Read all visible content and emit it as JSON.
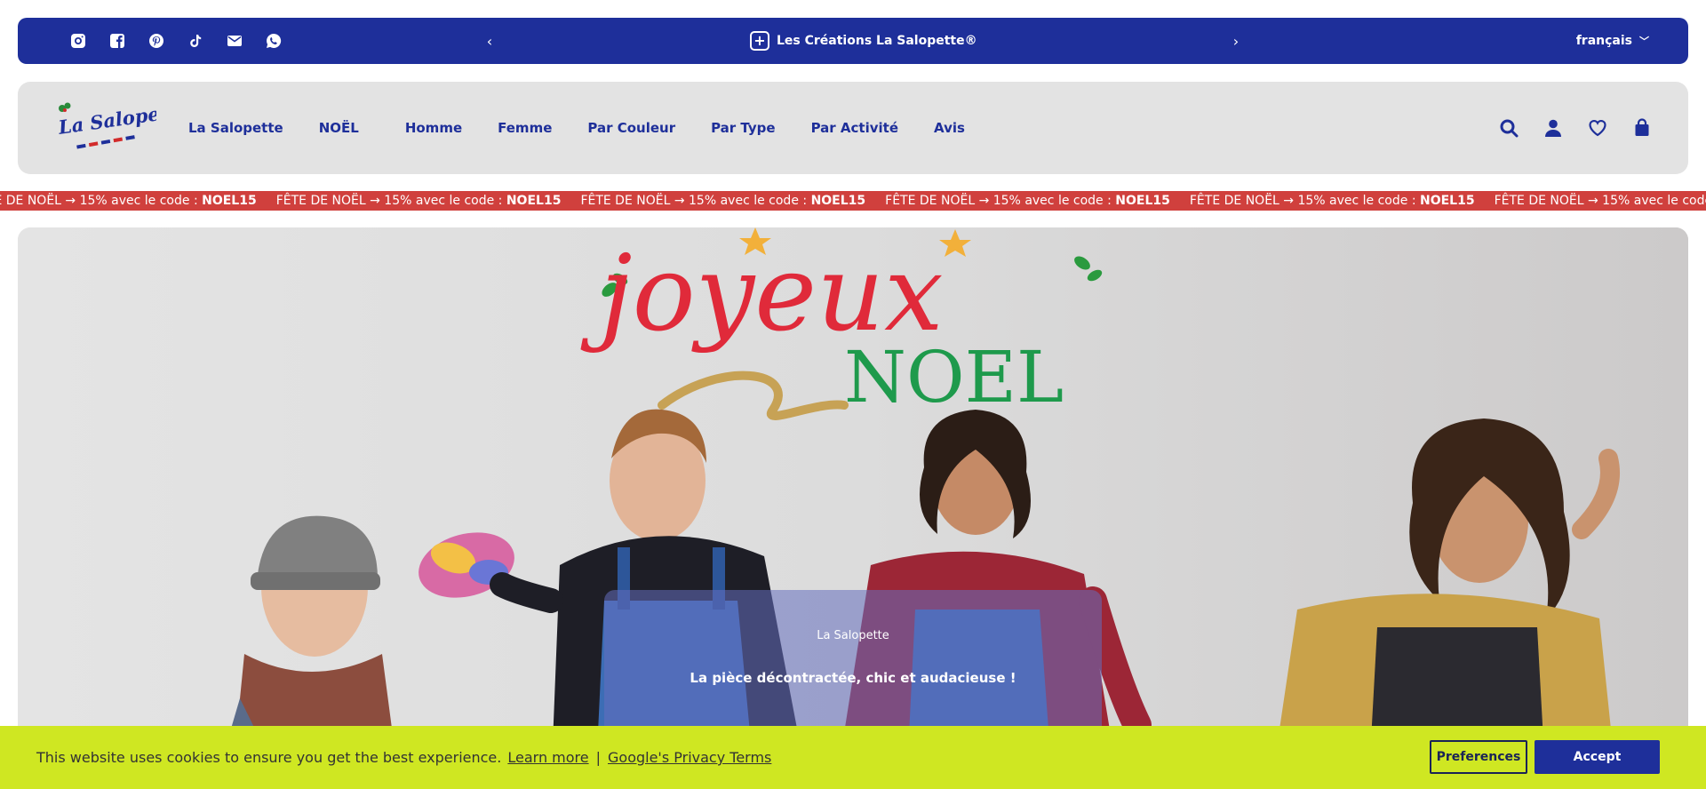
{
  "topbar": {
    "socials": [
      "instagram-icon",
      "facebook-icon",
      "pinterest-icon",
      "tiktok-icon",
      "email-icon",
      "whatsapp-icon"
    ],
    "prev": "‹",
    "next": "›",
    "announcement": "Les Créations La Salopette®",
    "language": "français",
    "bg_color": "#1e2f9a"
  },
  "header": {
    "logo_text": "La Salopette",
    "nav": [
      "La Salopette",
      "NOËL",
      "Homme",
      "Femme",
      "Par Couleur",
      "Par Type",
      "Par Activité",
      "Avis"
    ],
    "icons": [
      "search-icon",
      "account-icon",
      "wishlist-icon",
      "cart-icon"
    ]
  },
  "marquee": {
    "text": "FÊTE DE NOËL → 15% avec le code : ",
    "code": "NOEL15",
    "bg_color": "#d0403d"
  },
  "hero": {
    "headline_script": "joyeux",
    "headline_noel": "NOEL",
    "eyebrow": "La Salopette",
    "tagline": "La pièce décontractée, chic et audacieuse !"
  },
  "cookie": {
    "message": "This website uses cookies to ensure you get the best experience.",
    "learn_more": "Learn more",
    "separator": "|",
    "privacy": "Google's Privacy Terms",
    "preferences": "Preferences",
    "accept": "Accept",
    "bg_color": "#cfe722"
  }
}
